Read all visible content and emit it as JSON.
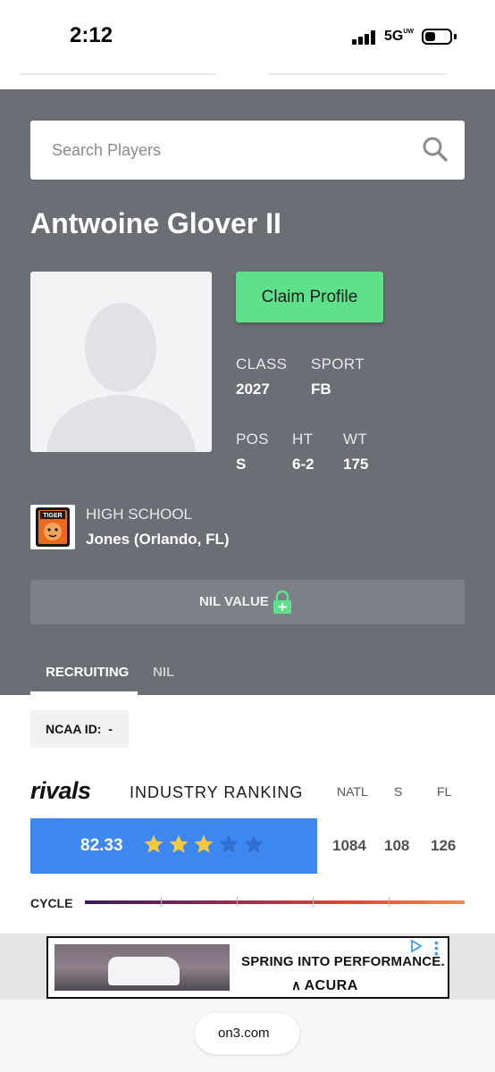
{
  "status_bar": {
    "time": "2:12",
    "network": "5G",
    "network_sub": "UW"
  },
  "search": {
    "placeholder": "Search Players"
  },
  "player": {
    "name": "Antwoine Glover II",
    "claim_label": "Claim Profile",
    "stats": {
      "class_label": "CLASS",
      "class_value": "2027",
      "sport_label": "SPORT",
      "sport_value": "FB",
      "pos_label": "POS",
      "pos_value": "S",
      "ht_label": "HT",
      "ht_value": "6-2",
      "wt_label": "WT",
      "wt_value": "175"
    },
    "school_label": "HIGH SCHOOL",
    "school_value": "Jones (Orlando, FL)",
    "school_logo_text": "TIGER"
  },
  "nil": {
    "label": "NIL VALUE"
  },
  "tabs": [
    {
      "label": "RECRUITING",
      "active": true
    },
    {
      "label": "NIL",
      "active": false
    }
  ],
  "ncaa": {
    "text": "NCAA ID:  -"
  },
  "ranking": {
    "brand": "rivals",
    "title": "INDUSTRY RANKING",
    "columns": [
      "NATL",
      "S",
      "FL"
    ],
    "score": "82.33",
    "stars_filled": 3,
    "stars_total": 5,
    "values": [
      "1084",
      "108",
      "126"
    ],
    "cycle_label": "CYCLE"
  },
  "ad": {
    "headline": "SPRING INTO PERFORMANCE.",
    "brand": "ACURA"
  },
  "browser": {
    "url": "on3.com"
  },
  "colors": {
    "hero_bg": "#6c6e76",
    "claim_green": "#5fe08a",
    "score_blue": "#3d87f0",
    "star_gold": "#f5c842",
    "star_empty": "#2f6fd0"
  }
}
